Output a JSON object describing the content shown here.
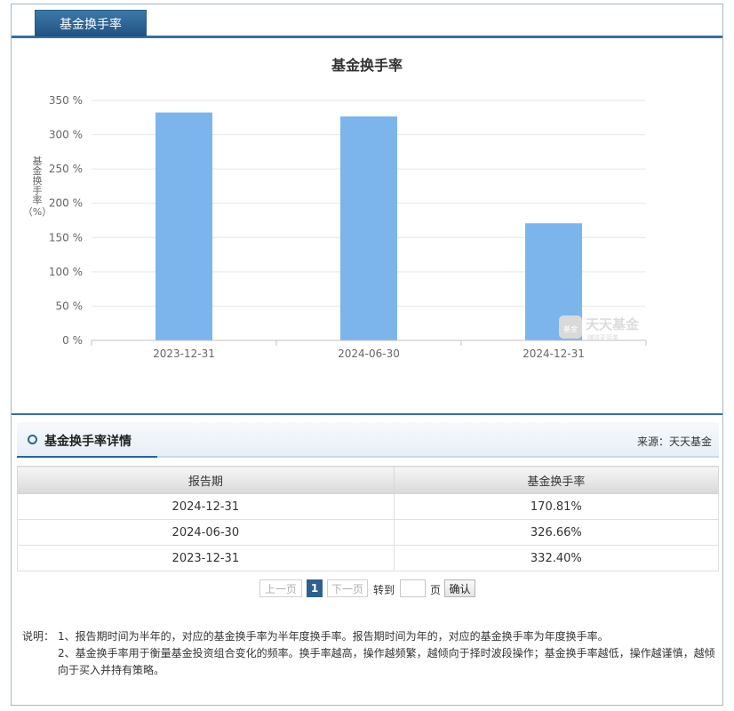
{
  "tab": {
    "label": "基金换手率"
  },
  "chart_data": {
    "type": "bar",
    "title": "基金换手率",
    "ylabel": "基金换手率（%）",
    "xlabel": "",
    "categories": [
      "2023-12-31",
      "2024-06-30",
      "2024-12-31"
    ],
    "values": [
      332.4,
      326.66,
      170.81
    ],
    "ylim": [
      0,
      350
    ],
    "yticks": [
      "0 %",
      "50 %",
      "100 %",
      "150 %",
      "200 %",
      "250 %",
      "300 %",
      "350 %"
    ],
    "grid": true,
    "bar_color": "#7cb5ec",
    "watermark": {
      "text": "天天基金",
      "subtext": "赚钱更简单",
      "badge": "基金"
    }
  },
  "detail": {
    "title": "基金换手率详情",
    "source": "来源：天天基金",
    "columns": [
      "报告期",
      "基金换手率"
    ],
    "rows": [
      [
        "2024-12-31",
        "170.81%"
      ],
      [
        "2024-06-30",
        "326.66%"
      ],
      [
        "2023-12-31",
        "332.40%"
      ]
    ]
  },
  "pager": {
    "prev": "上一页",
    "current": "1",
    "next": "下一页",
    "goto": "转到",
    "page_unit": "页",
    "confirm": "确认"
  },
  "notes": {
    "label": "说明：",
    "item1": "1、报告期时间为半年的，对应的基金换手率为半年度换手率。报告期时间为年的，对应的基金换手率为年度换手率。",
    "item2": "2、基金换手率用于衡量基金投资组合变化的频率。换手率越高，操作越频繁，越倾向于择时波段操作；基金换手率越低，操作越谨慎，越倾向于买入并持有策略。"
  },
  "colors": {
    "accent": "#2b6593",
    "bar": "#7cb5ec"
  }
}
